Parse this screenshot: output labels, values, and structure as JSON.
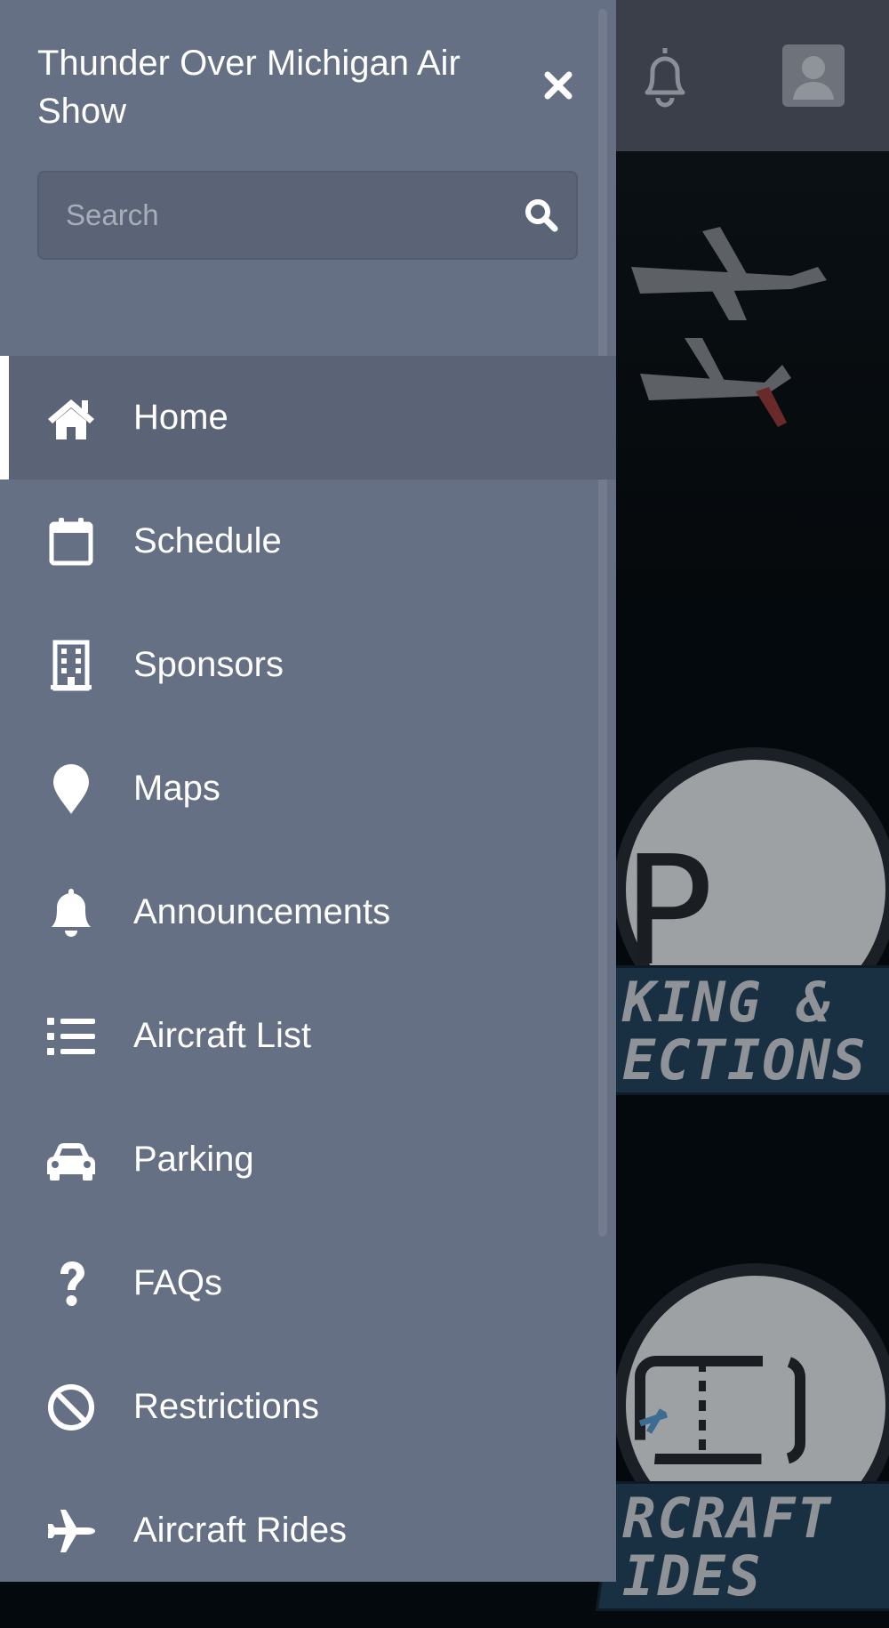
{
  "drawer": {
    "title": "Thunder Over Michigan Air Show",
    "close_icon": "close-icon",
    "search": {
      "placeholder": "Search",
      "value": "",
      "icon": "search-icon"
    },
    "items": [
      {
        "label": "Home",
        "icon": "home-icon",
        "active": true
      },
      {
        "label": "Schedule",
        "icon": "calendar-icon",
        "active": false
      },
      {
        "label": "Sponsors",
        "icon": "building-icon",
        "active": false
      },
      {
        "label": "Maps",
        "icon": "map-pin-icon",
        "active": false
      },
      {
        "label": "Announcements",
        "icon": "bell-icon",
        "active": false
      },
      {
        "label": "Aircraft List",
        "icon": "list-icon",
        "active": false
      },
      {
        "label": "Parking",
        "icon": "car-icon",
        "active": false
      },
      {
        "label": "FAQs",
        "icon": "question-icon",
        "active": false
      },
      {
        "label": "Restrictions",
        "icon": "ban-icon",
        "active": false
      },
      {
        "label": "Aircraft Rides",
        "icon": "plane-icon",
        "active": false
      }
    ]
  },
  "background": {
    "header": {
      "notification_icon": "bell-outline-icon",
      "profile_icon": "user-avatar-icon"
    },
    "tiles": [
      {
        "banner_lines": [
          "KING &",
          "ECTIONS"
        ]
      },
      {
        "banner_lines": [
          "RCRAFT",
          "IDES"
        ]
      }
    ]
  },
  "colors": {
    "drawer_bg": "#667085",
    "drawer_active": "#5b6477",
    "header_bg": "#3a3f49",
    "text": "#ffffff"
  }
}
